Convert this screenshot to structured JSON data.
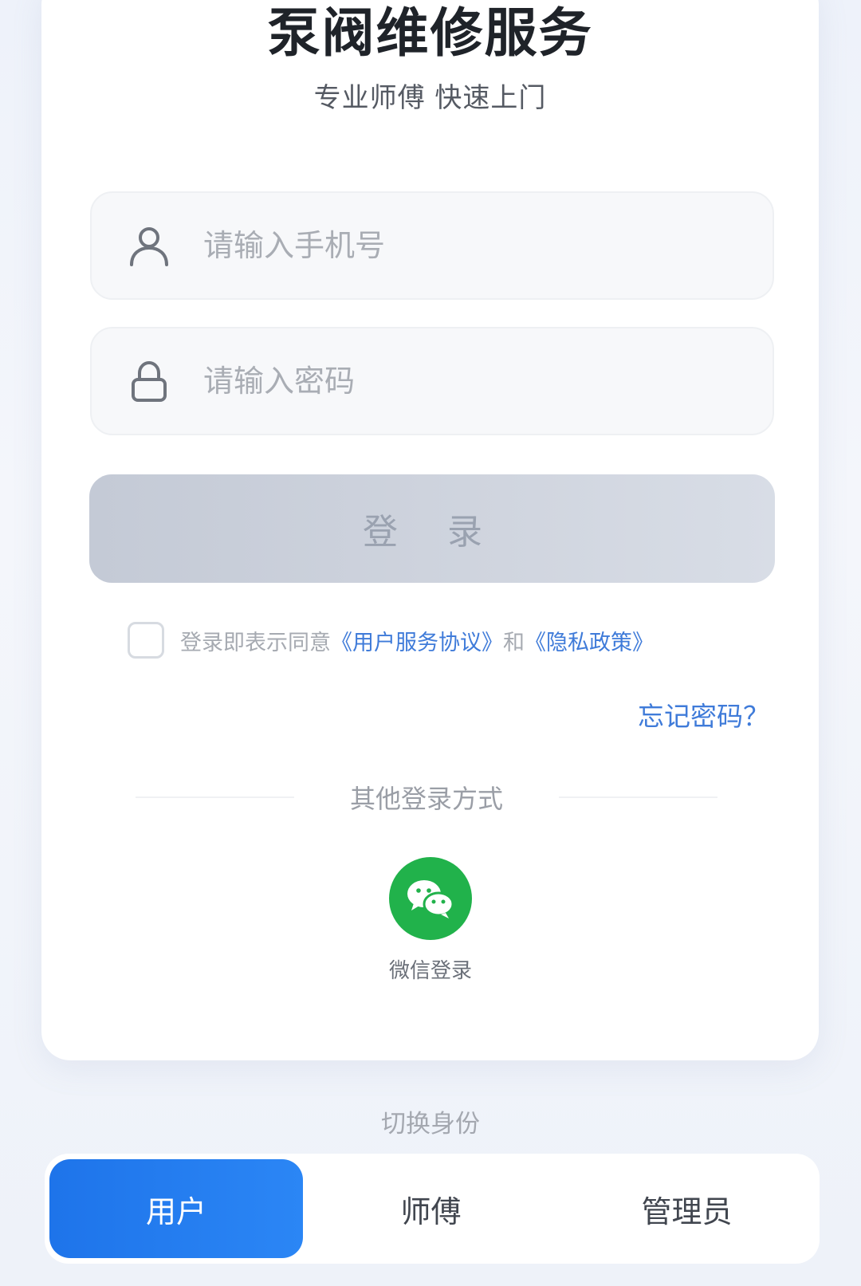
{
  "header": {
    "title": "泵阀维修服务",
    "subtitle": "专业师傅 快速上门"
  },
  "form": {
    "phone_placeholder": "请输入手机号",
    "password_placeholder": "请输入密码",
    "login_label": "登 录",
    "agree_prefix": "登录即表示同意",
    "agreement_link": "《用户服务协议》",
    "agree_and": "和",
    "privacy_link": "《隐私政策》",
    "forgot_label": "忘记密码？"
  },
  "other_login": {
    "heading": "其他登录方式",
    "wechat_label": "微信登录"
  },
  "roles": {
    "heading": "切换身份",
    "items": [
      {
        "label": "用户",
        "active": true
      },
      {
        "label": "师傅",
        "active": false
      },
      {
        "label": "管理员",
        "active": false
      }
    ]
  },
  "colors": {
    "accent": "#1e74ea",
    "link": "#3f7bd9",
    "wechat": "#21b24b"
  }
}
